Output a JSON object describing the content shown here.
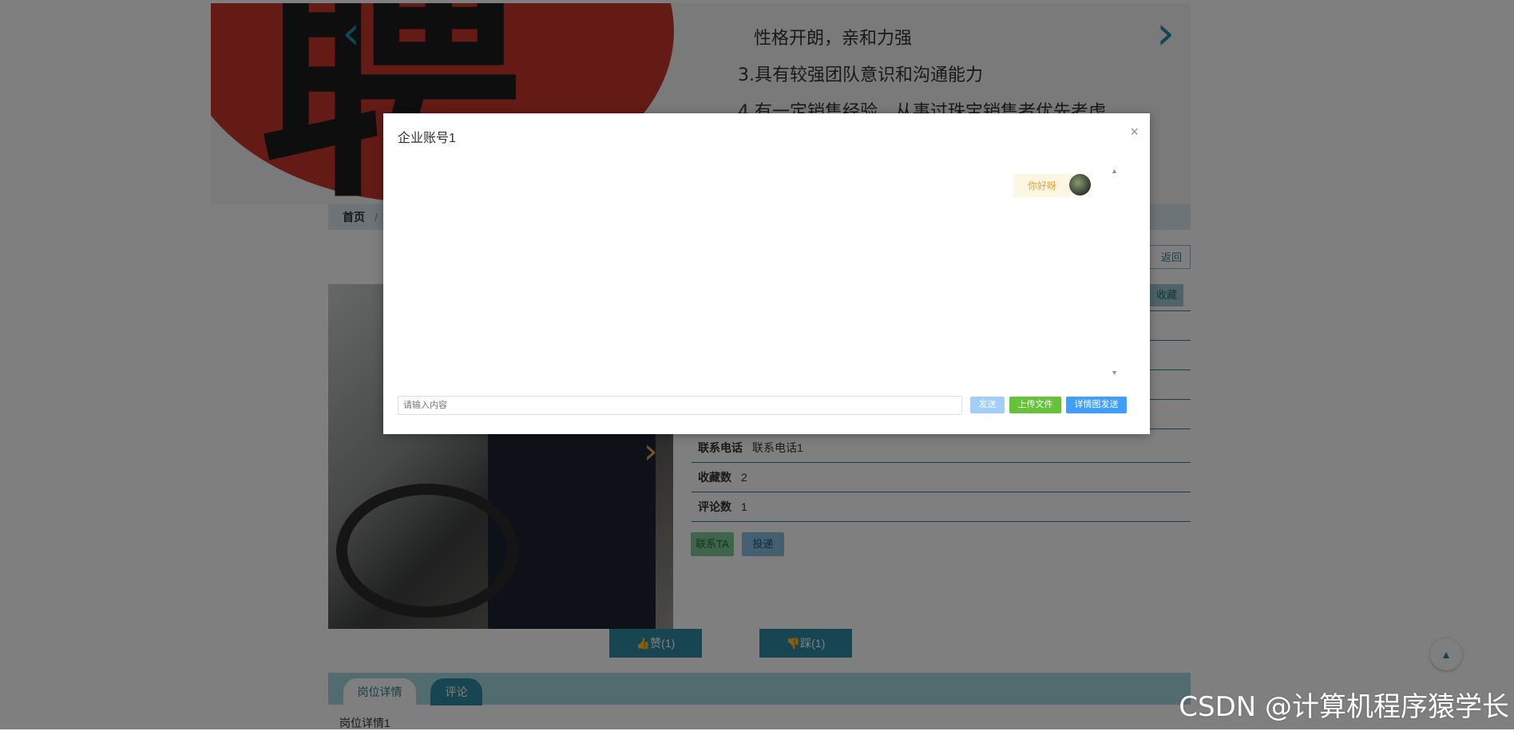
{
  "banner": {
    "char": "聘",
    "lines": [
      "性格开朗，亲和力强",
      "3.具有较强团队意识和沟通能力",
      "4.有一定销售经验，从事过珠宝销售者优先考虑"
    ]
  },
  "breadcrumb": {
    "home": "首页",
    "separator": "/"
  },
  "actions": {
    "back": "返回",
    "favorite": "收藏"
  },
  "details": [
    {
      "label": "联系电话",
      "value": "联系电话1"
    },
    {
      "label": "收藏数",
      "value": "2"
    },
    {
      "label": "评论数",
      "value": "1"
    }
  ],
  "buttons": {
    "contact": "联系TA",
    "deliver": "投递",
    "like": "赞(1)",
    "dislike": "踩(1)"
  },
  "tabs": {
    "detail": "岗位详情",
    "comment": "评论",
    "detail_title": "岗位详情1"
  },
  "watermark": "CSDN @计算机程序猿学长",
  "modal": {
    "title": "企业账号1",
    "messages": [
      {
        "text": "你好呀",
        "side": "right"
      }
    ],
    "input_placeholder": "请输入内容",
    "send": "发送",
    "upload": "上传文件",
    "detail_send": "详情图发送"
  },
  "icons": {
    "close": "close-icon",
    "prev": "chevron-left-icon",
    "next": "chevron-right-icon",
    "like": "thumb-up-icon",
    "dislike": "thumb-down-icon",
    "top": "arrow-up-icon"
  },
  "colors": {
    "accent": "#2f8aa5",
    "send": "#a0cfff",
    "upload": "#67c23a",
    "detail_send": "#409eff",
    "bubble_text": "#e6a23c"
  }
}
